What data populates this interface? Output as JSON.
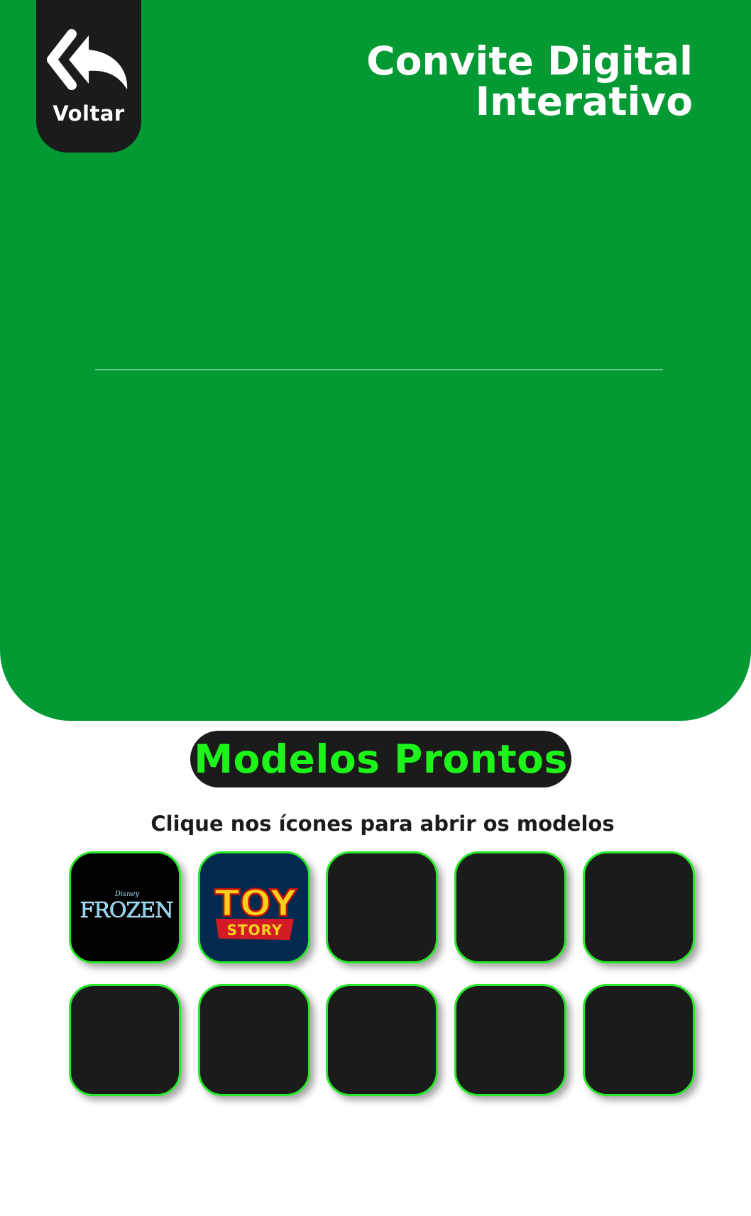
{
  "header": {
    "back_label": "Voltar",
    "title_line1": "Convite Digital",
    "title_line2": "Interativo"
  },
  "models": {
    "heading": "Modelos Prontos",
    "instruction": "Clique nos ícones para abrir os modelos",
    "tiles": [
      {
        "name": "frozen",
        "logo_text": "FROZEN",
        "logo_small": "Disney"
      },
      {
        "name": "toy-story",
        "logo_line1": "TOY",
        "logo_line2": "STORY"
      },
      {
        "name": "empty"
      },
      {
        "name": "empty"
      },
      {
        "name": "empty"
      },
      {
        "name": "empty"
      },
      {
        "name": "empty"
      },
      {
        "name": "empty"
      },
      {
        "name": "empty"
      },
      {
        "name": "empty"
      }
    ]
  },
  "colors": {
    "hero_green": "#039933",
    "accent_green": "#1df51a",
    "dark": "#1b1b1b",
    "toy_story_bg": "#022a4f",
    "toy_story_yellow": "#f7d21b",
    "toy_story_red": "#d31b25"
  }
}
